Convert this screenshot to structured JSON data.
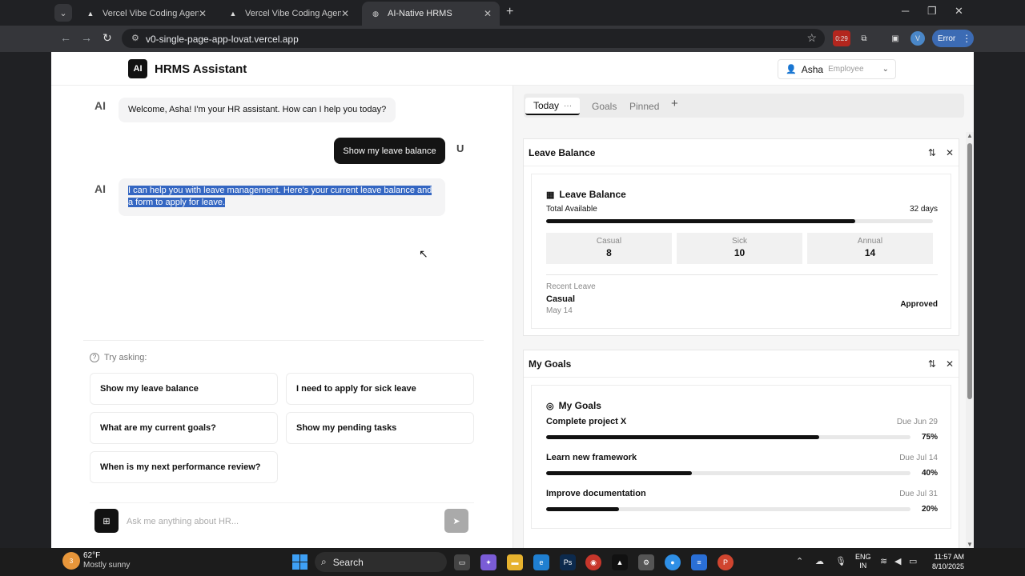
{
  "browser": {
    "tabs": [
      {
        "title": "Vercel Vibe Coding Agent",
        "active": false
      },
      {
        "title": "Vercel Vibe Coding Agent",
        "active": false
      },
      {
        "title": "AI-Native HRMS",
        "active": true
      }
    ],
    "url": "v0-single-page-app-lovat.vercel.app",
    "recording_badge": "0:29",
    "profile_initial": "V",
    "error_label": "Error"
  },
  "header": {
    "logo": "AI",
    "title": "HRMS Assistant",
    "user": {
      "name": "Asha",
      "role": "Employee"
    }
  },
  "chat": {
    "messages": [
      {
        "from": "AI",
        "text": "Welcome, Asha! I'm your HR assistant. How can I help you today?"
      },
      {
        "from": "U",
        "text": "Show my leave balance"
      },
      {
        "from": "AI",
        "text_line1": "I can help you with leave management. Here's your current leave balance and",
        "text_line2": "a form to apply for leave."
      }
    ],
    "try_asking_label": "Try asking:",
    "suggestions": [
      "Show my leave balance",
      "I need to apply for sick leave",
      "What are my current goals?",
      "Show my pending tasks",
      "When is my next performance review?"
    ],
    "input_placeholder": "Ask me anything about HR..."
  },
  "panel": {
    "tabs": [
      "Today",
      "Goals",
      "Pinned"
    ],
    "leave_widget": {
      "header": "Leave Balance",
      "card_title": "Leave Balance",
      "total_label": "Total Available",
      "total_value": "32 days",
      "total_progress_fraction": 0.8,
      "types": [
        {
          "label": "Casual",
          "value": "8"
        },
        {
          "label": "Sick",
          "value": "10"
        },
        {
          "label": "Annual",
          "value": "14"
        }
      ],
      "recent_label": "Recent Leave",
      "recent_type": "Casual",
      "recent_date": "May 14",
      "recent_status": "Approved"
    },
    "goals_widget": {
      "header": "My Goals",
      "card_title": "My Goals",
      "goals": [
        {
          "name": "Complete project X",
          "due": "Due Jun 29",
          "percent_label": "75%",
          "percent": 75
        },
        {
          "name": "Learn new framework",
          "due": "Due Jul 14",
          "percent_label": "40%",
          "percent": 40
        },
        {
          "name": "Improve documentation",
          "due": "Due Jul 31",
          "percent_label": "20%",
          "percent": 20
        }
      ]
    }
  },
  "taskbar": {
    "weather_badge": "3",
    "weather_temp": "62°F",
    "weather_cond": "Mostly sunny",
    "search_label": "Search",
    "lang_line1": "ENG",
    "lang_line2": "IN",
    "time": "11:57 AM",
    "date": "8/10/2025"
  },
  "colors": {
    "accent_dark": "#111111",
    "selection": "#3466c2",
    "error_chip": "#3c6bb4"
  }
}
